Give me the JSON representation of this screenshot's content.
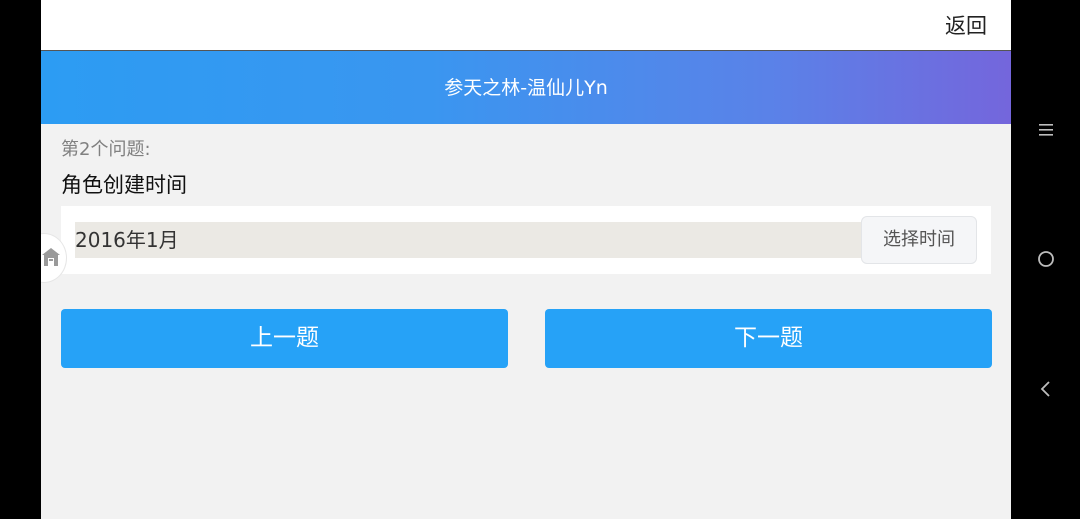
{
  "topbar": {
    "back_label": "返回"
  },
  "header": {
    "title": "参天之林-温仙儿Yn"
  },
  "question": {
    "number_label": "第2个问题:",
    "text": "角色创建时间"
  },
  "answer": {
    "value": "2016年1月",
    "pick_button_label": "选择时间"
  },
  "navigation": {
    "prev_label": "上一题",
    "next_label": "下一题"
  },
  "floating_button": {
    "icon": "home-icon"
  },
  "system_nav": {
    "icons": [
      "menu-icon",
      "home-circle-icon",
      "back-chevron-icon"
    ]
  },
  "colors": {
    "accent_button": "#26a2f7",
    "header_gradient_start": "#2c9cf3",
    "header_gradient_end": "#7466dc",
    "page_background": "#f2f2f2",
    "answer_field_background": "#ebe9e4"
  }
}
